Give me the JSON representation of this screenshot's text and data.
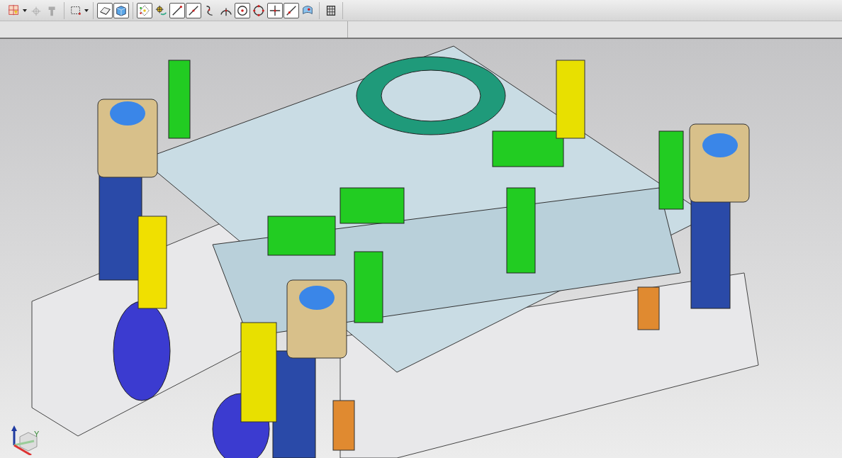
{
  "toolbar": {
    "groups": [
      {
        "buttons": [
          {
            "selected": false,
            "disabled": false,
            "dropdown": true
          },
          {
            "selected": false,
            "disabled": true,
            "dropdown": false
          },
          {
            "selected": false,
            "disabled": true,
            "dropdown": false
          }
        ]
      },
      {
        "buttons": [
          {
            "selected": false,
            "disabled": false,
            "dropdown": true
          }
        ]
      },
      {
        "buttons": [
          {
            "selected": true,
            "disabled": false,
            "dropdown": false
          },
          {
            "selected": true,
            "disabled": false,
            "dropdown": false
          }
        ]
      },
      {
        "buttons": [
          {
            "selected": true,
            "disabled": false,
            "dropdown": false
          },
          {
            "selected": false,
            "disabled": false,
            "dropdown": false
          },
          {
            "selected": true,
            "disabled": false,
            "dropdown": false
          },
          {
            "selected": true,
            "disabled": false,
            "dropdown": false
          },
          {
            "selected": false,
            "disabled": false,
            "dropdown": false
          },
          {
            "selected": false,
            "disabled": false,
            "dropdown": false
          },
          {
            "selected": true,
            "disabled": false,
            "dropdown": false
          },
          {
            "selected": false,
            "disabled": false,
            "dropdown": false
          },
          {
            "selected": true,
            "disabled": false,
            "dropdown": false
          },
          {
            "selected": true,
            "disabled": false,
            "dropdown": false
          },
          {
            "selected": false,
            "disabled": false,
            "dropdown": false
          }
        ]
      },
      {
        "buttons": [
          {
            "selected": false,
            "disabled": false,
            "dropdown": false
          }
        ]
      }
    ]
  },
  "viewport": {
    "triad": {
      "axis_label": "Y"
    }
  }
}
